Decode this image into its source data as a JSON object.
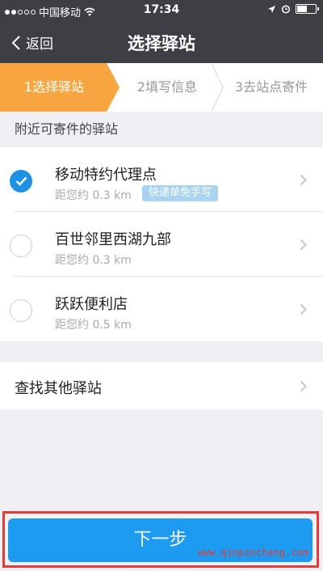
{
  "status_bar": {
    "carrier": "中国移动",
    "time": "17:34"
  },
  "nav": {
    "back_label": "返回",
    "title": "选择驿站"
  },
  "steps": [
    {
      "label": "1选择驿站",
      "active": true
    },
    {
      "label": "2填写信息",
      "active": false
    },
    {
      "label": "3去站点寄件",
      "active": false
    }
  ],
  "section": {
    "title": "附近可寄件的驿站"
  },
  "stations": [
    {
      "name": "移动特约代理点",
      "distance": "距您约 0.3 km",
      "tag": "快递单免手写",
      "selected": true
    },
    {
      "name": "百世邻里西湖九部",
      "distance": "距您约 0.3 km",
      "tag": "",
      "selected": false
    },
    {
      "name": "跃跃便利店",
      "distance": "距您约 0.5 km",
      "tag": "",
      "selected": false
    }
  ],
  "other": {
    "label": "查找其他驿站"
  },
  "footer": {
    "next_label": "下一步",
    "watermark": "www.qinpinchang.com"
  },
  "colors": {
    "nav_bg": "#3d3f45",
    "step_active": "#f7a540",
    "primary": "#1c9bf0",
    "tag_bg": "#a9d3f2",
    "highlight": "#e53935"
  }
}
